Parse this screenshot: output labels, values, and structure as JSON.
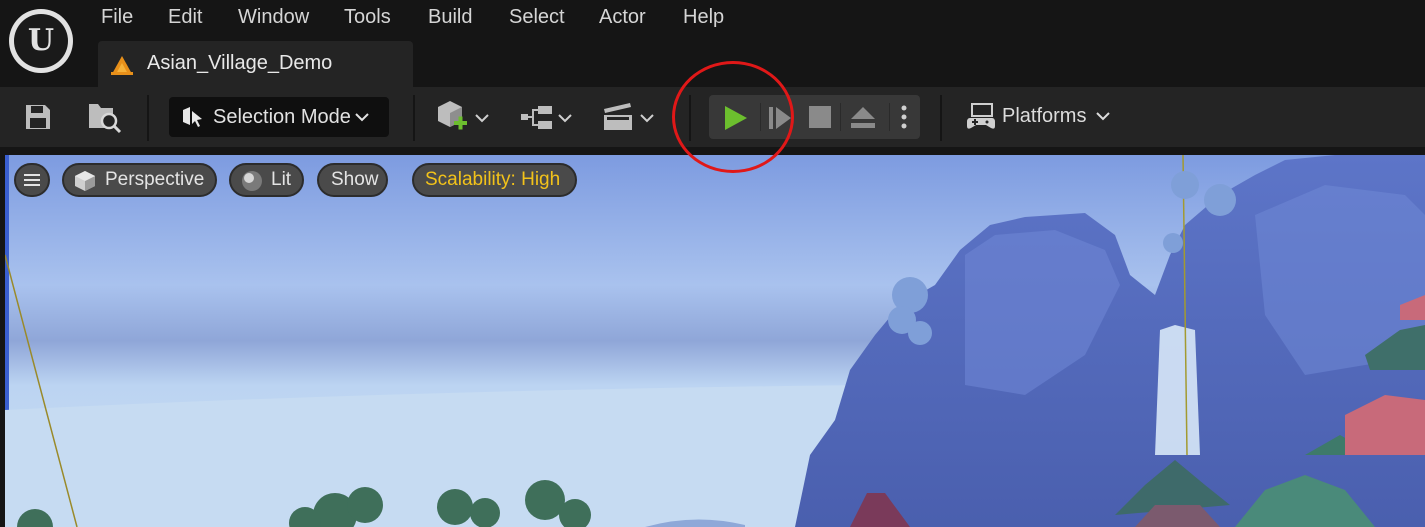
{
  "app": {
    "logo_icon": "unreal-engine-logo",
    "menu": [
      "File",
      "Edit",
      "Window",
      "Tools",
      "Build",
      "Select",
      "Actor",
      "Help"
    ]
  },
  "tab": {
    "title": "Asian_Village_Demo",
    "icon": "level-icon"
  },
  "toolbar": {
    "save_icon": "save-icon",
    "browse_icon": "content-browser-icon",
    "selection_mode_label": "Selection Mode",
    "add_icon": "add-actor-icon",
    "blueprint_icon": "blueprint-icon",
    "cinematics_icon": "cinematics-icon",
    "play_controls": {
      "play_icon": "play-icon",
      "play_color": "#6cbf2e",
      "advance_frame_icon": "advance-frame-icon",
      "stop_icon": "stop-icon",
      "eject_icon": "eject-icon",
      "options_icon": "more-options-icon"
    },
    "platforms_label": "Platforms"
  },
  "viewport": {
    "menu_icon": "hamburger-icon",
    "perspective_label": "Perspective",
    "lit_label": "Lit",
    "show_label": "Show",
    "scalability_label": "Scalability: High",
    "scalability_color": "#f2c21a",
    "scene": "asian-village-landscape"
  },
  "annotation": {
    "color": "#e01818",
    "target": "play-button"
  }
}
